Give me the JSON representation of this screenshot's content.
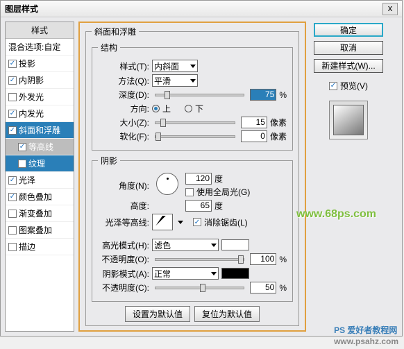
{
  "title": "图层样式",
  "close": "x",
  "left": {
    "header": "样式",
    "blend": "混合选项:自定",
    "items": [
      {
        "label": "投影",
        "chk": true
      },
      {
        "label": "内阴影",
        "chk": true
      },
      {
        "label": "外发光",
        "chk": false
      },
      {
        "label": "内发光",
        "chk": true
      },
      {
        "label": "斜面和浮雕",
        "chk": true,
        "sel": true
      },
      {
        "label": "等高线",
        "chk": true,
        "sub": true
      },
      {
        "label": "纹理",
        "chk": false,
        "sub": true,
        "subsel": true
      },
      {
        "label": "光泽",
        "chk": true
      },
      {
        "label": "颜色叠加",
        "chk": true
      },
      {
        "label": "渐变叠加",
        "chk": false
      },
      {
        "label": "图案叠加",
        "chk": false
      },
      {
        "label": "描边",
        "chk": false
      }
    ]
  },
  "mid": {
    "group_title": "斜面和浮雕",
    "struct_title": "结构",
    "style_lbl": "样式(T):",
    "style_val": "内斜面",
    "method_lbl": "方法(Q):",
    "method_val": "平滑",
    "depth_lbl": "深度(D):",
    "depth_val": "75",
    "pct": "%",
    "dir_lbl": "方向:",
    "dir_up": "上",
    "dir_down": "下",
    "size_lbl": "大小(Z):",
    "size_val": "15",
    "px": "像素",
    "soften_lbl": "软化(F):",
    "soften_val": "0",
    "shadow_title": "阴影",
    "angle_lbl": "角度(N):",
    "angle_val": "120",
    "deg": "度",
    "global_lbl": "使用全局光(G)",
    "alt_lbl": "高度:",
    "alt_val": "65",
    "gloss_lbl": "光泽等高线:",
    "anti_lbl": "消除锯齿(L)",
    "hl_mode_lbl": "高光模式(H):",
    "hl_mode_val": "滤色",
    "hl_opac_lbl": "不透明度(O):",
    "hl_opac_val": "100",
    "sh_mode_lbl": "阴影模式(A):",
    "sh_mode_val": "正常",
    "sh_opac_lbl": "不透明度(C):",
    "sh_opac_val": "50",
    "btn_default": "设置为默认值",
    "btn_reset": "复位为默认值"
  },
  "right": {
    "ok": "确定",
    "cancel": "取消",
    "newstyle": "新建样式(W)...",
    "preview_lbl": "预览(V)"
  },
  "wm1": "www.68ps.com",
  "wm2": "PS 爱好者教程网",
  "wm3": "www.psahz.com"
}
